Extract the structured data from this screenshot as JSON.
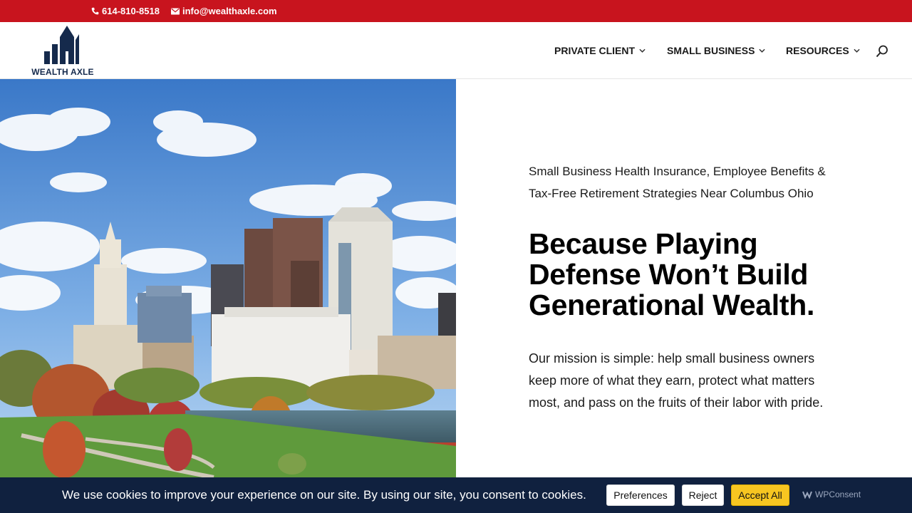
{
  "topbar": {
    "phone": "614-810-8518",
    "email": "info@wealthaxle.com",
    "background": "#c8141e"
  },
  "header": {
    "logo_text": "WEALTH AXLE",
    "nav": [
      {
        "label": "PRIVATE CLIENT",
        "icon": "chevron-down-icon"
      },
      {
        "label": "SMALL BUSINESS",
        "icon": "chevron-down-icon"
      },
      {
        "label": "RESOURCES",
        "icon": "chevron-down-icon"
      }
    ],
    "search_icon": "search-icon"
  },
  "hero": {
    "image": "columbus-ohio-skyline-photo",
    "kicker": "Small Business Health Insurance, Employee Benefits & Tax-Free Retirement Strategies Near Columbus Ohio",
    "headline": "Because Playing Defense Won’t Build Generational Wealth.",
    "mission": "Our mission is simple: help small business owners keep more of what they earn, protect what matters most, and pass on the fruits of their labor with pride."
  },
  "cookie_banner": {
    "message": "We use cookies to improve your experience on our site. By using our site, you consent to cookies.",
    "preferences_label": "Preferences",
    "reject_label": "Reject",
    "accept_label": "Accept All",
    "brand": "WPConsent",
    "background": "#10213f",
    "accept_color": "#f7c621"
  }
}
